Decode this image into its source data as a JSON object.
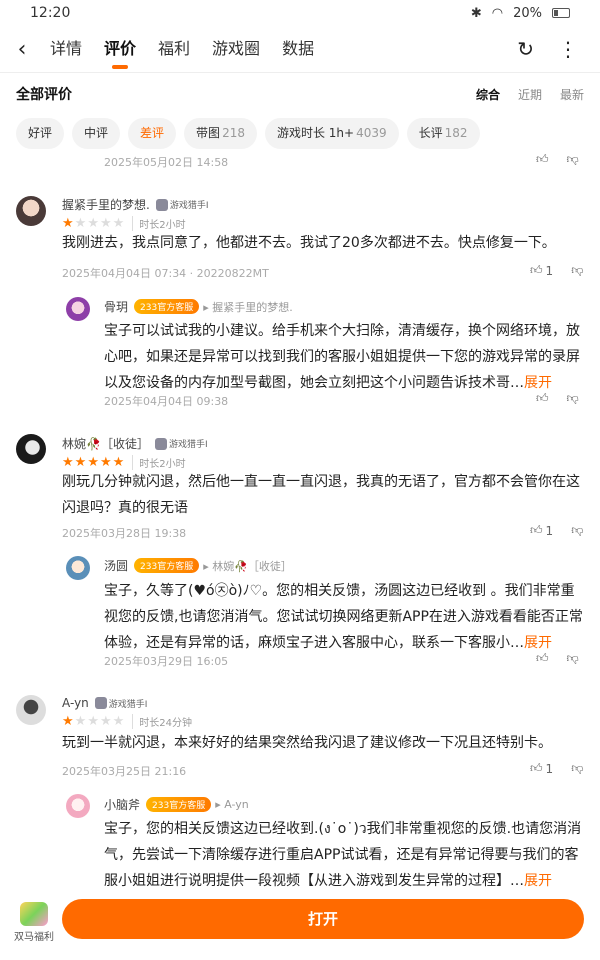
{
  "status": {
    "time": "12:20",
    "battery": "20%"
  },
  "nav": {
    "tabs": [
      "详情",
      "评价",
      "福利",
      "游戏圈",
      "数据"
    ],
    "active": "评价"
  },
  "section": {
    "title": "全部评价",
    "sort": [
      "综合",
      "近期",
      "最新"
    ]
  },
  "filters": [
    {
      "label": "好评",
      "count": ""
    },
    {
      "label": "中评",
      "count": ""
    },
    {
      "label": "差评",
      "count": ""
    },
    {
      "label": "带图",
      "count": "218"
    },
    {
      "label": "游戏时长 1h+",
      "count": "4039"
    },
    {
      "label": "长评",
      "count": "182"
    }
  ],
  "top_date": "2025年05月02日 14:58",
  "reviews": [
    {
      "name": "握紧手里的梦想.",
      "badge": "游戏猎手I",
      "rating": 1,
      "duration": "时长2小时",
      "text": "我刚进去，我点同意了，他都进不去。我试了20多次都进不去。快点修复一下。",
      "meta": "2025年04月04日 07:34 · 20220822MT",
      "likes": "1",
      "reply": {
        "name": "骨玥",
        "badge": "233官方客服",
        "to": "握紧手里的梦想.",
        "text": "宝子可以试试我的小建议。给手机来个大扫除，清清缓存，换个网络环境，放心吧，如果还是异常可以找到我们的客服小姐姐提供一下您的游戏异常的录屏以及您设备的内存加型号截图，她会立刻把这个小问题告诉技术哥…",
        "more": "展开",
        "date": "2025年04月04日 09:38"
      }
    },
    {
      "name": "林婉🥀［收徒］",
      "badge": "游戏猎手I",
      "rating": 5,
      "duration": "时长2小时",
      "text": "刚玩几分钟就闪退，然后他一直一直一直闪退，我真的无语了，官方都不会管你在这闪退吗？真的很无语",
      "meta": "2025年03月28日 19:38",
      "likes": "1",
      "reply": {
        "name": "汤圆",
        "badge": "233官方客服",
        "to": "林婉🥀［收徒］",
        "text": "宝子，久等了(♥ó㉨ò)ﾉ♡。您的相关反馈，汤圆这边已经收到 。我们非常重视您的反馈,也请您消消气。您试试切换网络更新APP在进入游戏看看能否正常体验，还是有异常的话，麻烦宝子进入客服中心，联系一下客服小…",
        "more": "展开",
        "date": "2025年03月29日 16:05"
      }
    },
    {
      "name": "A-yn",
      "badge": "游戏猎手I",
      "rating": 1,
      "duration": "时长24分钟",
      "text": "玩到一半就闪退，本来好好的结果突然给我闪退了建议修改一下况且还特别卡。",
      "meta": "2025年03月25日 21:16",
      "likes": "1",
      "reply": {
        "name": "小脑斧",
        "badge": "233官方客服",
        "to": "A-yn",
        "text": "宝子，您的相关反馈这边已经收到.(ง˙o˙)ว我们非常重视您的反馈.也请您消消气，先尝试一下清除缓存进行重启APP试试看，还是有异常记得要与我们的客服小姐姐进行说明提供一段视频【从进入游戏到发生异常的过程】…",
        "more": "展开"
      }
    }
  ],
  "bottom": {
    "gift_label": "双马福利",
    "open_label": "打开"
  },
  "colors": {
    "accent": "#ff6a00",
    "star_on": "#ff7a00"
  }
}
